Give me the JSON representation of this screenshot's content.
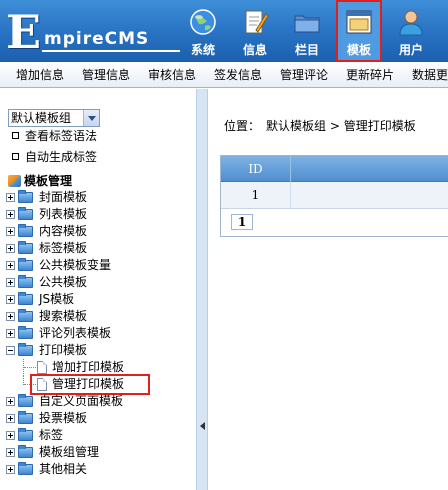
{
  "logo": {
    "initial": "E",
    "rest": "mpireCMS"
  },
  "topnav": [
    {
      "label": "系统",
      "icon": "globe-icon"
    },
    {
      "label": "信息",
      "icon": "edit-document-icon"
    },
    {
      "label": "栏目",
      "icon": "folder-icon"
    },
    {
      "label": "模板",
      "icon": "template-window-icon",
      "active": true
    },
    {
      "label": "用户",
      "icon": "user-icon"
    }
  ],
  "subnav": [
    "增加信息",
    "管理信息",
    "审核信息",
    "签发信息",
    "管理评论",
    "更新碎片",
    "数据更新"
  ],
  "left": {
    "template_group_select": "默认模板组",
    "links": [
      "查看标签语法",
      "自动生成标签"
    ],
    "tree_root": "模板管理",
    "nodes": [
      "封面模板",
      "列表模板",
      "内容模板",
      "标签模板",
      "公共模板变量",
      "公共模板",
      "JS模板",
      "搜索模板",
      "评论列表模板",
      "打印模板"
    ],
    "print_children": [
      "增加打印模板",
      "管理打印模板"
    ],
    "nodes_after": [
      "自定义页面模板",
      "投票模板",
      "标签",
      "模板组管理",
      "其他相关"
    ]
  },
  "main": {
    "breadcrumb_label": "位置：",
    "breadcrumb_path": "默认模板组 > 管理打印模板",
    "table_header_id": "ID",
    "row_id": "1",
    "page": "1"
  },
  "colors": {
    "header_blue": "#2b76c6",
    "highlight_red": "#e0201b",
    "splitter": "#d6e4f3"
  }
}
